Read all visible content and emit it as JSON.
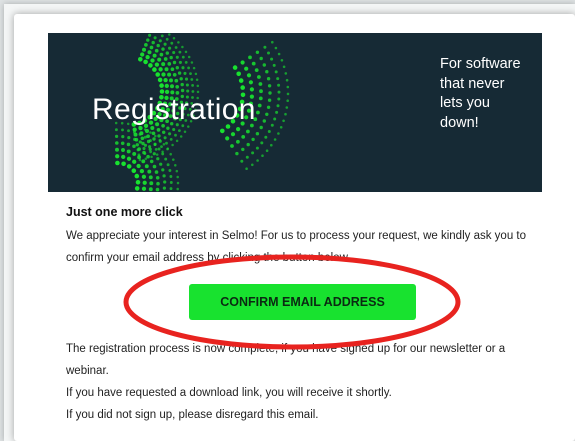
{
  "banner": {
    "title": "Registration",
    "tagline": "For software that never lets you down!",
    "background": "#162a35",
    "accent": "#18e22f"
  },
  "email": {
    "heading": "Just one more click",
    "intro": "We appreciate your interest in Selmo! For us to process your request, we kindly ask you to confirm your email address by clicking the button below.",
    "confirm_label": "CONFIRM EMAIL ADDRESS",
    "footer_lines": [
      "The registration process is now complete, if you have signed up for our newsletter or a webinar.",
      "If you have requested a download link, you will receive it shortly.",
      "If you did not sign up, please disregard this email."
    ]
  },
  "annotation": {
    "color": "#e8231f"
  }
}
